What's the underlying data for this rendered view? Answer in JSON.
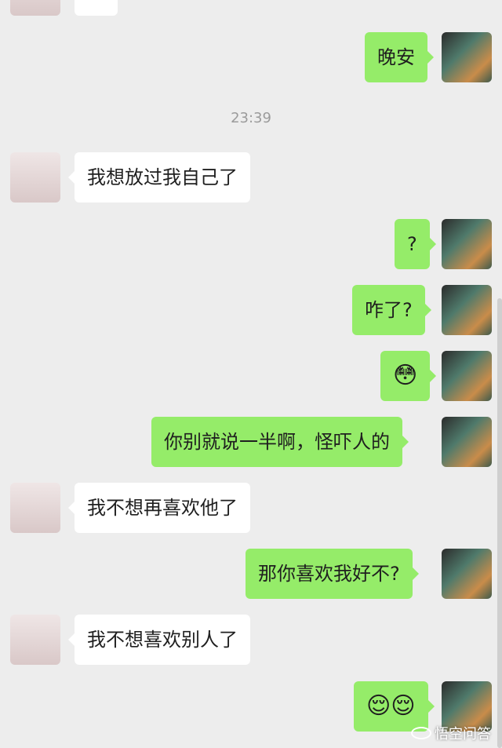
{
  "timestamp": "23:39",
  "messages": [
    {
      "side": "right",
      "text": "晚安"
    },
    {
      "side": "left",
      "text": "我想放过我自己了"
    },
    {
      "side": "right",
      "text": "?"
    },
    {
      "side": "right",
      "text": "咋了?"
    },
    {
      "side": "right",
      "text": "😳"
    },
    {
      "side": "right",
      "text": "你别就说一半啊，怪吓人的"
    },
    {
      "side": "left",
      "text": "我不想再喜欢他了"
    },
    {
      "side": "right",
      "text": "那你喜欢我好不?"
    },
    {
      "side": "left",
      "text": "我不想喜欢别人了"
    },
    {
      "side": "right",
      "text": "😌😌"
    }
  ],
  "watermark": "悟空问答",
  "colors": {
    "background": "#ededed",
    "sent_bubble": "#95ec69",
    "received_bubble": "#ffffff"
  }
}
